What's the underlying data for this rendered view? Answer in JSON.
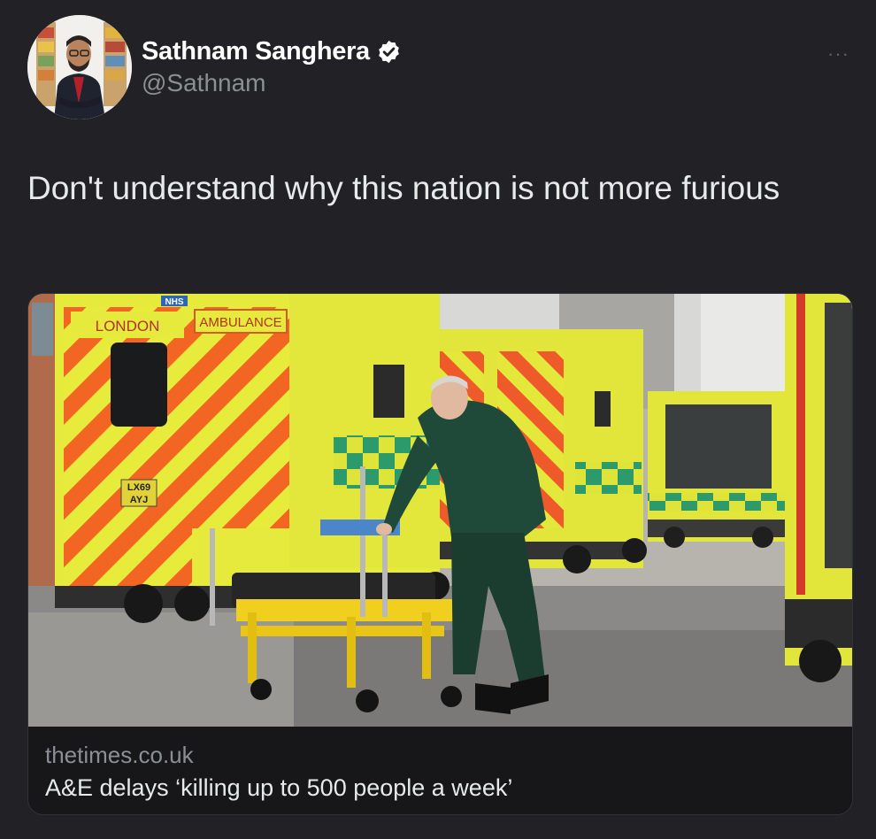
{
  "author": {
    "display_name": "Sathnam Sanghera",
    "handle": "@Sathnam",
    "verified": true,
    "avatar_icon": "profile-photo"
  },
  "more_icon": "more-options-icon",
  "tweet": {
    "text": "Don't understand why this nation is not more furious"
  },
  "card": {
    "domain": "thetimes.co.uk",
    "title": "A&E delays ‘killing up to 500 people a week’",
    "image_texts": {
      "london": "LONDON",
      "ambulance": "AMBULANCE",
      "nhs": "NHS",
      "plate_1": "LX69",
      "plate_2": "AYJ"
    }
  },
  "colors": {
    "background": "#222125",
    "accent_yellow": "#d8e33a",
    "accent_orange": "#f26522",
    "verified_badge": "#ffffff"
  }
}
